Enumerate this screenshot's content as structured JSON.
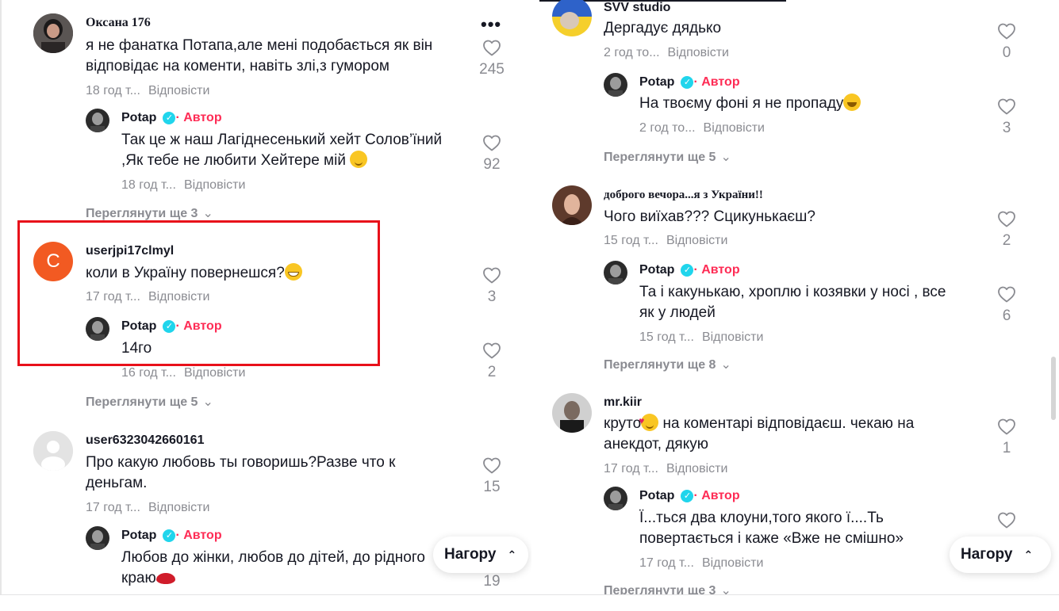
{
  "colors": {
    "accent": "#fe2c55",
    "verified": "#20d5ec",
    "highlight": "#e8101a",
    "muted": "#8a8b91",
    "text": "#161823"
  },
  "left": {
    "c1": {
      "user": "Оксана 176",
      "line1": "я не фанатка Потапа,але мені подобається як він",
      "line2": "відповідає на коменти, навіть злі,з гумором",
      "time": "18 год т...",
      "reply": "Відповісти",
      "likes": "245",
      "more_icon": "more-dots-icon"
    },
    "r1": {
      "user": "Potap",
      "sep": "·",
      "author": "Автор",
      "line1": "Так це ж наш Лагіднесенький хейт Солов’їний",
      "line2": ",Як тебе не любити Хейтере мій",
      "time": "18 год т...",
      "reply": "Відповісти",
      "likes": "92"
    },
    "more1": "Переглянути ще 3",
    "c2": {
      "avatar_letter": "C",
      "user": "userjpi17clmyl",
      "line1": "коли в Україну повернешся?",
      "time": "17 год т...",
      "reply": "Відповісти",
      "likes": "3"
    },
    "r2": {
      "user": "Potap",
      "sep": "·",
      "author": "Автор",
      "line1": "14го",
      "time": "16 год т...",
      "reply": "Відповісти",
      "likes": "2"
    },
    "more2": "Переглянути ще 5",
    "c3": {
      "user": "user6323042660161",
      "line1": "Про какую любовь ты говоришь?Разве что к",
      "line2": "деньгам.",
      "time": "17 год т...",
      "reply": "Відповісти",
      "likes": "15"
    },
    "r3": {
      "user": "Potap",
      "sep": "·",
      "author": "Автор",
      "line1": "Любов до жінки, любов до дітей, до рідного",
      "line2": "краю",
      "likes": "19"
    },
    "top_button": "Нагору"
  },
  "right": {
    "c1": {
      "user": "SVV studio",
      "line1": "Дергадує дядько",
      "time": "2 год то...",
      "reply": "Відповісти",
      "likes": "0"
    },
    "r1": {
      "user": "Potap",
      "sep": "·",
      "author": "Автор",
      "line1": "На твоєму фоні я не пропаду",
      "time": "2 год то...",
      "reply": "Відповісти",
      "likes": "3"
    },
    "more1": "Переглянути ще 5",
    "c2": {
      "user": "доброго вечора...я з України!!",
      "line1": "Чого виїхав??? Сцикунькаєш?",
      "time": "15 год т...",
      "reply": "Відповісти",
      "likes": "2"
    },
    "r2": {
      "user": "Potap",
      "sep": "·",
      "author": "Автор",
      "line1": "Та і какунькаю, хроплю і козявки у носі , все",
      "line2": "як у людей",
      "time": "15 год т...",
      "reply": "Відповісти",
      "likes": "6"
    },
    "more2": "Переглянути ще 8",
    "c3": {
      "user": "mr.kiir",
      "line1a": "круто",
      "line1b": " на коментарі відповідаєш. чекаю на",
      "line2": "анекдот, дякую",
      "time": "17 год т...",
      "reply": "Відповісти",
      "likes": "1"
    },
    "r3": {
      "user": "Potap",
      "sep": "·",
      "author": "Автор",
      "line1": "Ї...ться два клоуни,того якого ї....Ть",
      "line2": "повертається і каже «Вже не смішно»",
      "time": "17 год т...",
      "reply": "Відповісти"
    },
    "more3": "Переглянути ще 3",
    "top_button": "Нагору"
  }
}
